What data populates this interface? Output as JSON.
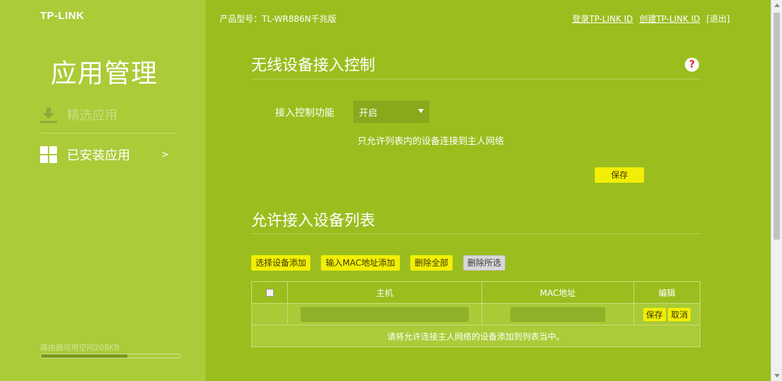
{
  "brand": {
    "logo": "TP-LINK"
  },
  "header": {
    "model": "产品型号：TL-WR886N千兆版",
    "login": "登录TP-LINK ID",
    "create": "创建TP-LINK ID",
    "logout": "[退出]"
  },
  "sidebar": {
    "title": "应用管理",
    "items": [
      {
        "label": "精选应用",
        "icon": "download-icon"
      },
      {
        "label": "已安装应用",
        "icon": "grid-icon",
        "chevron": ">"
      }
    ],
    "storage_label": "路由器可用空间208KB",
    "storage_fraction": 0.62
  },
  "access": {
    "title": "无线设备接入控制",
    "help_glyph": "?",
    "control_label": "接入控制功能",
    "control_value": "开启",
    "hint": "只允许列表内的设备连接到主人网络",
    "save_label": "保存"
  },
  "list": {
    "title": "允许接入设备列表",
    "buttons": {
      "select_add": "选择设备添加",
      "mac_add": "输入MAC地址添加",
      "delete_all": "删除全部",
      "delete_selected": "删除所选"
    },
    "columns": {
      "host": "主机",
      "mac": "MAC地址",
      "edit": "编辑"
    },
    "row_actions": {
      "save": "保存",
      "cancel": "取消"
    },
    "empty_text": "请将允许连接主人网络的设备添加到列表当中。"
  },
  "colors": {
    "background": "#9bbe1e",
    "sidebar": "#abcb38",
    "accent_button": "#f2ee06"
  }
}
